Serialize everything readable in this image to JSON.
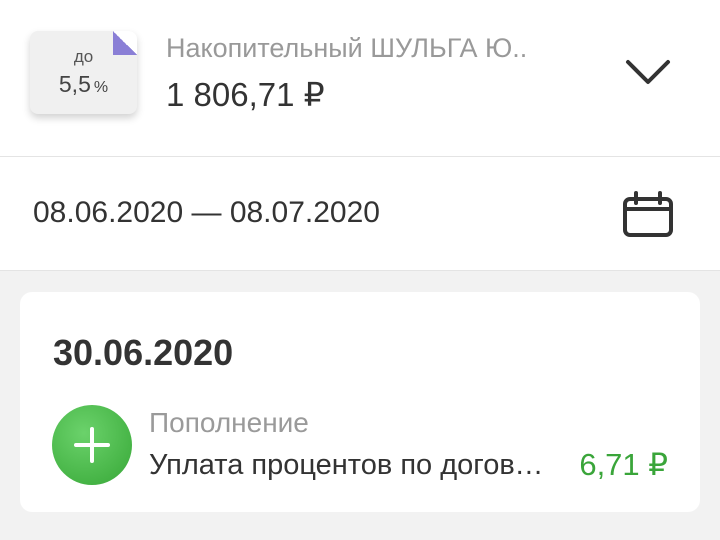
{
  "account": {
    "card_prefix": "до",
    "rate_value": "5,5",
    "rate_unit": "%",
    "name": "Накопительный ШУЛЬГА Ю..",
    "balance": "1 806,71 ₽",
    "expand_icon": "chevron-down-icon",
    "card_accent_color": "#8a7fd6"
  },
  "period": {
    "range": "08.06.2020 — 08.07.2020",
    "calendar_icon": "calendar-icon"
  },
  "transactions": [
    {
      "date": "30.06.2020",
      "icon": "plus-icon",
      "icon_color": "#46b446",
      "category": "Пополнение",
      "description": "Уплата процентов по договору",
      "amount": "6,71 ₽",
      "amount_color": "#3aa53a"
    }
  ]
}
